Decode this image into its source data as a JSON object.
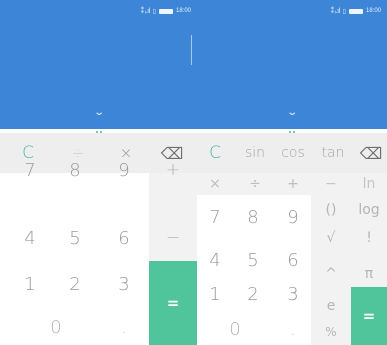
{
  "status": {
    "time": "18:00",
    "signal": "⁑ ᵢ.ıl",
    "sim": "▯"
  },
  "left": {
    "chevron": "⌄",
    "fn": {
      "clear": "C",
      "divide": "÷",
      "multiply": "×",
      "backspace": "⌫"
    },
    "side": {
      "plus": "+",
      "minus": "−",
      "equals": "="
    },
    "keys": {
      "k7": "7",
      "k8": "8",
      "k9": "9",
      "k4": "4",
      "k5": "5",
      "k6": "6",
      "k1": "1",
      "k2": "2",
      "k3": "3",
      "k0": "0",
      "dot": "."
    }
  },
  "right": {
    "chevron": "⌄",
    "fn": {
      "clear": "C",
      "sin": "sin",
      "cos": "cos",
      "tan": "tan",
      "backspace": "⌫"
    },
    "ops": {
      "multiply": "×",
      "divide": "÷",
      "plus": "+",
      "minus": "−",
      "ln": "ln"
    },
    "keys": {
      "k7": "7",
      "k8": "8",
      "k9": "9",
      "k4": "4",
      "k5": "5",
      "k6": "6",
      "k1": "1",
      "k2": "2",
      "k3": "3",
      "k0": "0",
      "dot": "."
    },
    "sci": {
      "parens": "()",
      "log": "log",
      "sqrt": "√",
      "factorial": "!",
      "power": "^",
      "pi": "π",
      "e": "e",
      "percent": "%"
    },
    "equals": "="
  },
  "colors": {
    "display": "#3d86d7",
    "accent": "#50c49b",
    "key_text": "#9a9a9a"
  }
}
